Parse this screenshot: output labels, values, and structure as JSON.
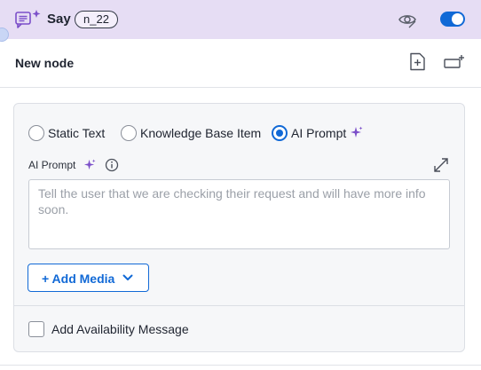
{
  "header": {
    "title": "Say",
    "node_id": "n_22",
    "icon": "chat-sparkle-icon",
    "toggle_on": true
  },
  "node": {
    "title": "New node"
  },
  "response_type": {
    "options": [
      {
        "label": "Static Text",
        "selected": false
      },
      {
        "label": "Knowledge Base Item",
        "selected": false
      },
      {
        "label": "AI Prompt",
        "selected": true
      }
    ]
  },
  "prompt_field": {
    "label": "AI Prompt",
    "placeholder": "Tell the user that we are checking their request and will have more info soon.",
    "value": ""
  },
  "add_media": {
    "label": "+ Add Media"
  },
  "availability": {
    "label": "Add Availability Message",
    "checked": false
  },
  "colors": {
    "header_bg": "#e6ddf4",
    "accent": "#1169d6",
    "sparkle": "#7b4fc9"
  }
}
